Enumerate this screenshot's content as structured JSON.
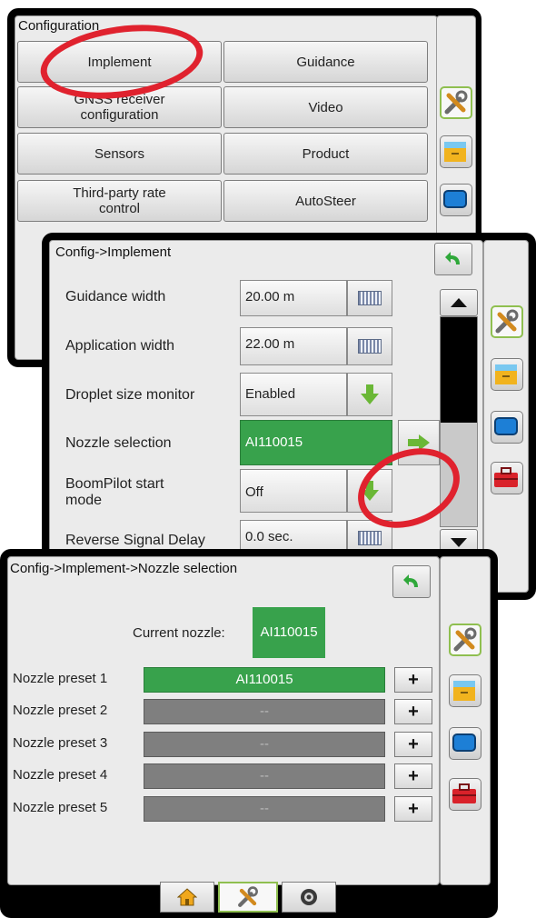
{
  "panel1": {
    "title": "Configuration",
    "buttons": [
      {
        "label": "Implement"
      },
      {
        "label": "Guidance"
      },
      {
        "label": "GNSS receiver configuration"
      },
      {
        "label": "Video"
      },
      {
        "label": "Sensors"
      },
      {
        "label": "Product"
      },
      {
        "label": "Third-party rate control"
      },
      {
        "label": "AutoSteer"
      }
    ]
  },
  "panel2": {
    "title": "Config->Implement",
    "rows": [
      {
        "label": "Guidance width",
        "value": "20.00 m",
        "control": "keyboard-icon"
      },
      {
        "label": "Application width",
        "value": "22.00 m",
        "control": "keyboard-icon"
      },
      {
        "label": "Droplet size monitor",
        "value": "Enabled",
        "control": "down-arrow-icon"
      },
      {
        "label": "Nozzle selection",
        "value": "AI110015",
        "control": "right-arrow-icon"
      },
      {
        "label": "BoomPilot start mode",
        "value": "Off",
        "control": "down-arrow-icon"
      },
      {
        "label": "Reverse Signal Delay",
        "value": "0.0 sec.",
        "control": "keyboard-icon"
      }
    ]
  },
  "panel3": {
    "title": "Config->Implement->Nozzle selection",
    "current_label": "Current nozzle:",
    "current_value": "AI110015",
    "presets": [
      {
        "label": "Nozzle preset 1",
        "value": "AI110015",
        "plus": "+"
      },
      {
        "label": "Nozzle preset 2",
        "value": "--",
        "plus": "+"
      },
      {
        "label": "Nozzle preset 3",
        "value": "--",
        "plus": "+"
      },
      {
        "label": "Nozzle preset 4",
        "value": "--",
        "plus": "+"
      },
      {
        "label": "Nozzle preset 5",
        "value": "--",
        "plus": "+"
      }
    ],
    "bottom_tabs": [
      "home-icon",
      "tools-icon",
      "camera-icon"
    ]
  },
  "colors": {
    "accent_green": "#38a24c",
    "highlight_red": "#e0222e",
    "panel_bg": "#000000"
  }
}
